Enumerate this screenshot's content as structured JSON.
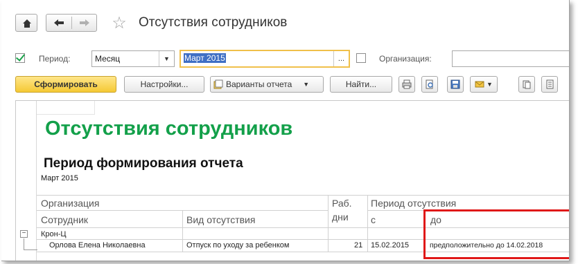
{
  "window": {
    "title": "Отсутствия сотрудников"
  },
  "filters": {
    "period_label": "Период:",
    "period_type_value": "Месяц",
    "period_value": "Март 2015",
    "period_dots": "...",
    "organization_label": "Организация:",
    "organization_value": ""
  },
  "toolbar": {
    "generate": "Сформировать",
    "settings": "Настройки...",
    "variants": "Варианты отчета",
    "find": "Найти..."
  },
  "report": {
    "title": "Отсутствия сотрудников",
    "period_heading": "Период формирования отчета",
    "period_value": "Март 2015",
    "columns": {
      "organization": "Организация",
      "employee": "Сотрудник",
      "absence_type": "Вид отсутствия",
      "work_days_line1": "Раб.",
      "work_days_line2": "дни",
      "absence_period": "Период отсутствия",
      "from": "с",
      "to": "до"
    },
    "group": {
      "collapse_symbol": "−",
      "name": "Крон-Ц"
    },
    "rows": [
      {
        "employee": "Орлова Елена Николаевна",
        "absence_type": "Отпуск по уходу за ребенком",
        "work_days": "21",
        "from": "15.02.2015",
        "to": "предположительно до 14.02.2018"
      }
    ]
  },
  "colors": {
    "title_green": "#13a04a",
    "highlight_red": "#e01818",
    "primary_button": "#f5c934"
  }
}
